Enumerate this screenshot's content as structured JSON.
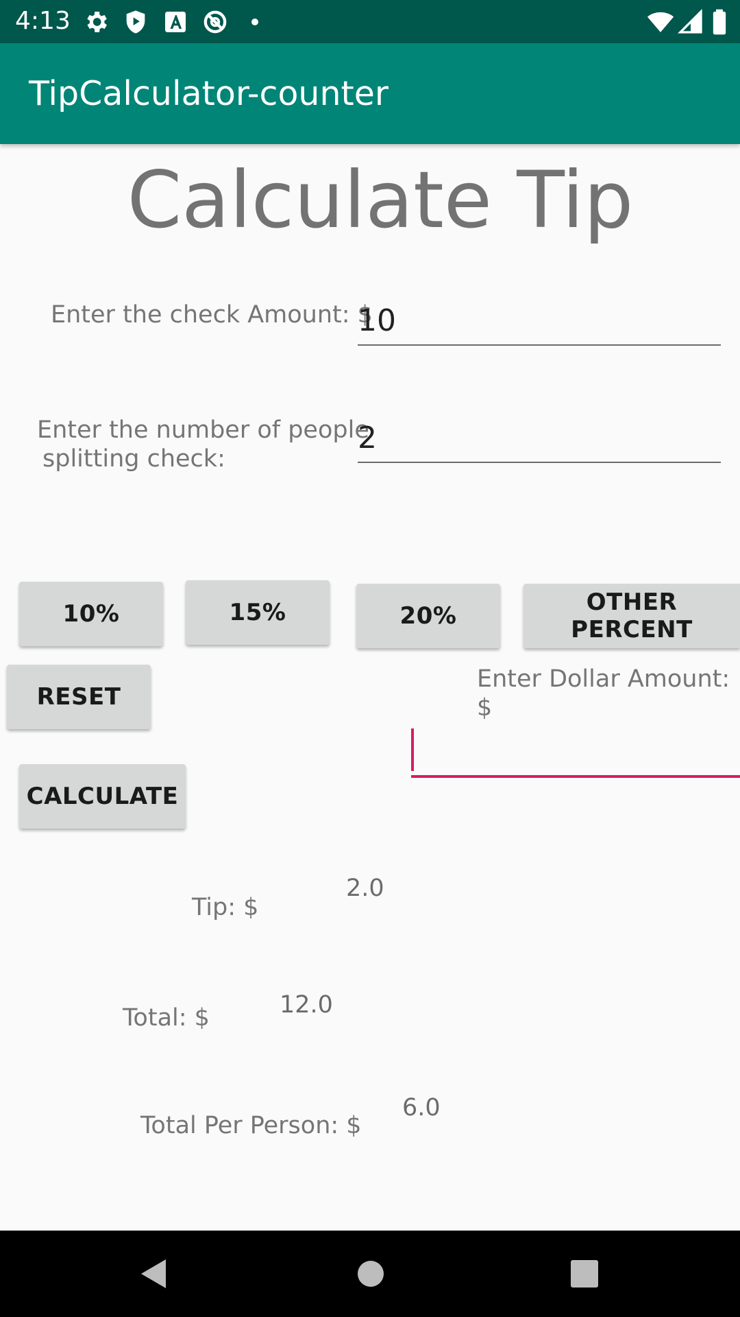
{
  "status_bar": {
    "time": "4:13",
    "left_icons": [
      "gear-icon",
      "shield-play-icon",
      "font-a-icon",
      "no-disturb-icon",
      "dot-icon"
    ],
    "right_icons": [
      "wifi-icon",
      "signal-icon",
      "battery-icon"
    ]
  },
  "app_bar": {
    "title": "TipCalculator-counter",
    "color": "#008577",
    "status_color": "#00574b"
  },
  "main": {
    "heading": "Calculate Tip",
    "check_amount": {
      "label": "Enter the check Amount: $",
      "value": "10"
    },
    "people": {
      "label_line1": "Enter the number of people",
      "label_line2": "splitting check:",
      "value": "2"
    },
    "percent_buttons": {
      "ten": "10%",
      "fifteen": "15%",
      "twenty": "20%",
      "other": "OTHER PERCENT"
    },
    "reset_label": "RESET",
    "dollar_amount": {
      "label": "Enter Dollar Amount: $",
      "value": "",
      "accent_color": "#d81b60"
    },
    "calculate_label": "CALCULATE",
    "results": {
      "tip_label": "Tip: $",
      "tip_value": "2.0",
      "total_label": "Total: $",
      "total_value": "12.0",
      "per_person_label": "Total Per Person: $",
      "per_person_value": "6.0"
    }
  },
  "nav_bar": {
    "icons": [
      "back-icon",
      "home-icon",
      "recents-icon"
    ]
  }
}
